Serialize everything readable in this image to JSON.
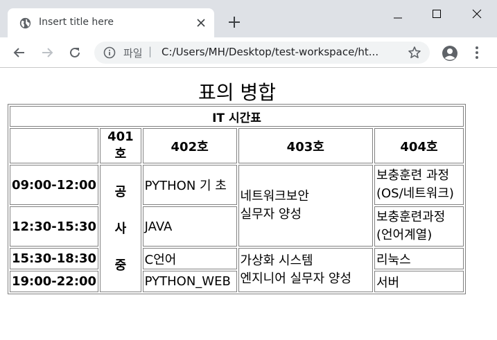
{
  "browser": {
    "tab_title": "Insert title here",
    "omnibox_label": "파일",
    "omnibox_separator": "|",
    "url": "C:/Users/MH/Desktop/test-workspace/ht..."
  },
  "page": {
    "title": "표의 병합"
  },
  "table": {
    "caption": "IT 시간표",
    "headers": [
      "",
      "401호",
      "402호",
      "403호",
      "404호"
    ],
    "times": [
      "09:00-12:00",
      "12:30-15:30",
      "15:30-18:30",
      "19:00-22:00"
    ],
    "room401_chars": [
      "공",
      "사",
      "중"
    ],
    "room402": [
      "PYTHON 기 초",
      "JAVA",
      "C언어",
      "PYTHON_WEB"
    ],
    "room403": [
      {
        "line1": "네트워크보안",
        "line2": "실무자 양성"
      },
      {
        "line1": "가상화 시스템",
        "line2": "엔지니어 실무자 양성"
      }
    ],
    "room404": [
      {
        "line1": "보충훈련 과정",
        "line2": "(OS/네트워크)"
      },
      {
        "line1": "보충훈련과정",
        "line2": "(언어계열)"
      },
      {
        "line1": "리눅스",
        "line2": ""
      },
      {
        "line1": "서버",
        "line2": ""
      }
    ]
  },
  "icons": {
    "favicon": "globe-icon",
    "tab_close": "close-icon",
    "new_tab": "plus-icon",
    "back": "arrow-left-icon",
    "forward": "arrow-right-icon",
    "reload": "reload-icon",
    "info": "info-icon",
    "bookmark": "star-icon",
    "profile": "profile-icon",
    "menu": "kebab-menu-icon"
  }
}
